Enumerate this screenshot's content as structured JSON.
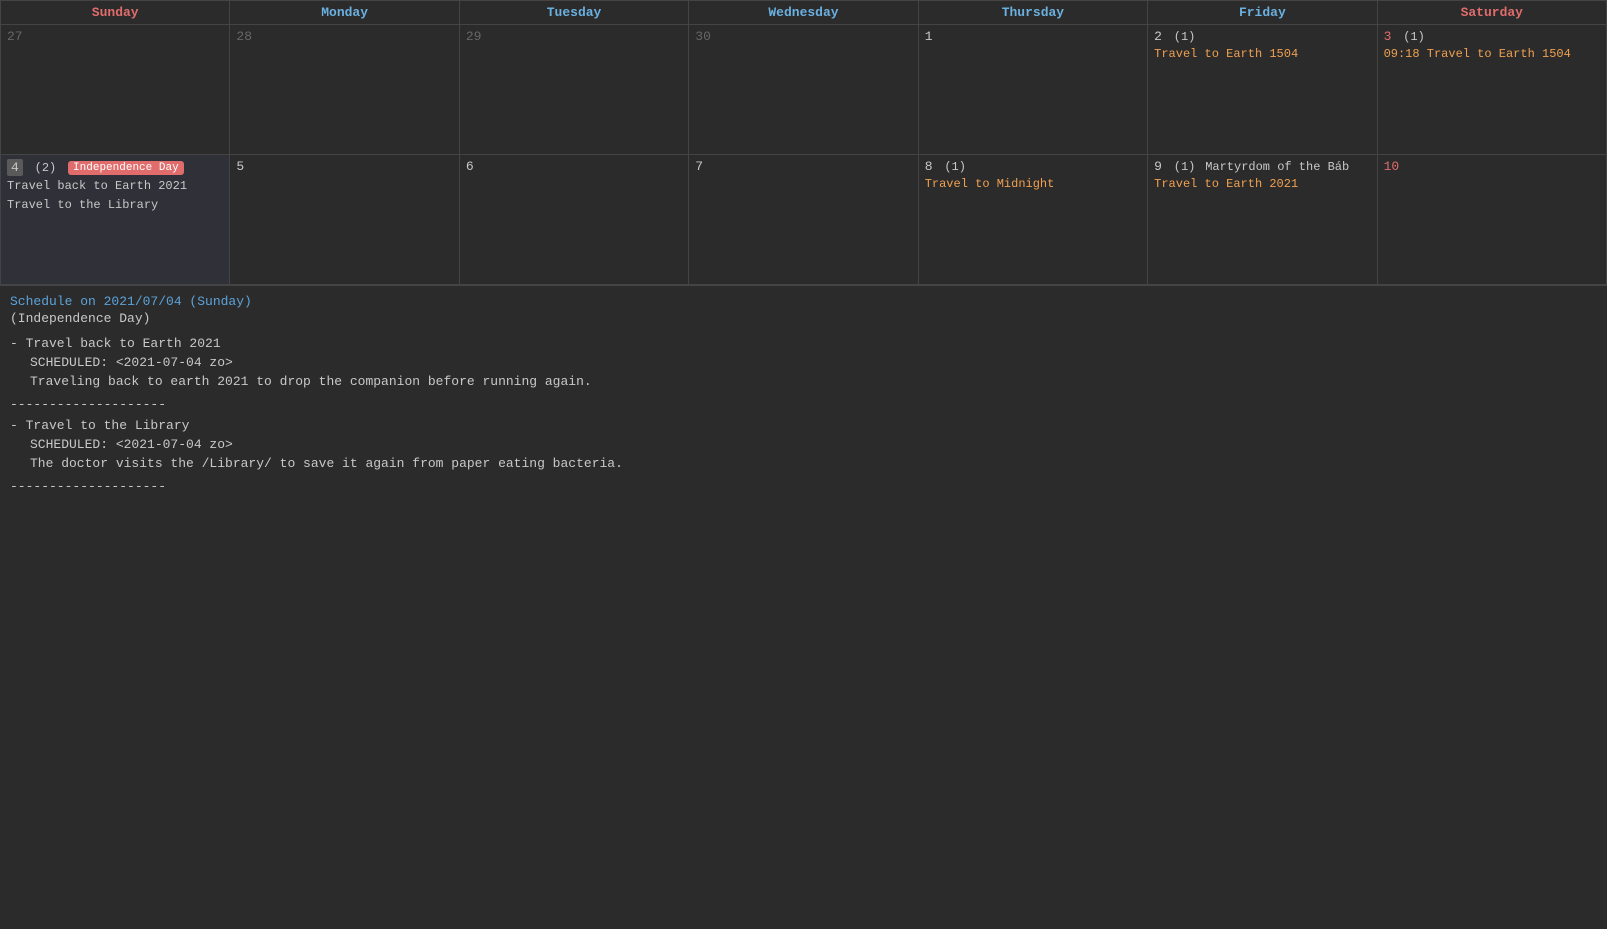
{
  "calendar": {
    "headers": [
      {
        "label": "Sunday",
        "class": "sunday"
      },
      {
        "label": "Monday",
        "class": "monday"
      },
      {
        "label": "Tuesday",
        "class": "tuesday"
      },
      {
        "label": "Wednesday",
        "class": "wednesday"
      },
      {
        "label": "Thursday",
        "class": "thursday"
      },
      {
        "label": "Friday",
        "class": "friday"
      },
      {
        "label": "Saturday",
        "class": "saturday"
      }
    ],
    "weeks": [
      [
        {
          "num": "27",
          "prev": true,
          "events": []
        },
        {
          "num": "28",
          "prev": true,
          "events": []
        },
        {
          "num": "29",
          "prev": true,
          "events": []
        },
        {
          "num": "30",
          "prev": true,
          "events": []
        },
        {
          "num": "1",
          "events": []
        },
        {
          "num": "2",
          "count": "(1)",
          "events": [
            {
              "text": "Travel to Earth 1504",
              "type": "orange"
            }
          ]
        },
        {
          "num": "3",
          "count": "(1)",
          "isSat": true,
          "events": [
            {
              "text": "09:18 Travel to Earth 1504",
              "type": "orange"
            }
          ]
        }
      ],
      [
        {
          "num": "4",
          "selected": true,
          "holiday": "Independence Day",
          "count": "(2)",
          "events": [
            {
              "text": "Travel back to Earth 2021",
              "type": "regular"
            },
            {
              "text": "Travel to the Library",
              "type": "regular"
            }
          ]
        },
        {
          "num": "5",
          "events": []
        },
        {
          "num": "6",
          "events": []
        },
        {
          "num": "7",
          "events": []
        },
        {
          "num": "8",
          "count": "(1)",
          "events": [
            {
              "text": "Travel to Midnight",
              "type": "orange"
            }
          ]
        },
        {
          "num": "9",
          "count": "(1)",
          "holiday": "Martyrdom of the Báb",
          "events": [
            {
              "text": "Travel to Earth 2021",
              "type": "orange"
            }
          ]
        },
        {
          "num": "10",
          "isSat": true,
          "events": []
        }
      ]
    ]
  },
  "schedule": {
    "title": "Schedule on 2021/07/04 (Sunday)",
    "subtitle": "(Independence Day)",
    "entries": [
      {
        "title": "- Travel back to Earth 2021",
        "scheduled": "SCHEDULED: <2021-07-04 zo>",
        "desc": "Traveling back to earth 2021 to drop the companion before running again."
      },
      {
        "title": "- Travel to the Library",
        "scheduled": "SCHEDULED: <2021-07-04 zo>",
        "desc": "The doctor visits the /Library/ to save it again from paper eating bacteria."
      }
    ],
    "divider": "--------------------"
  }
}
